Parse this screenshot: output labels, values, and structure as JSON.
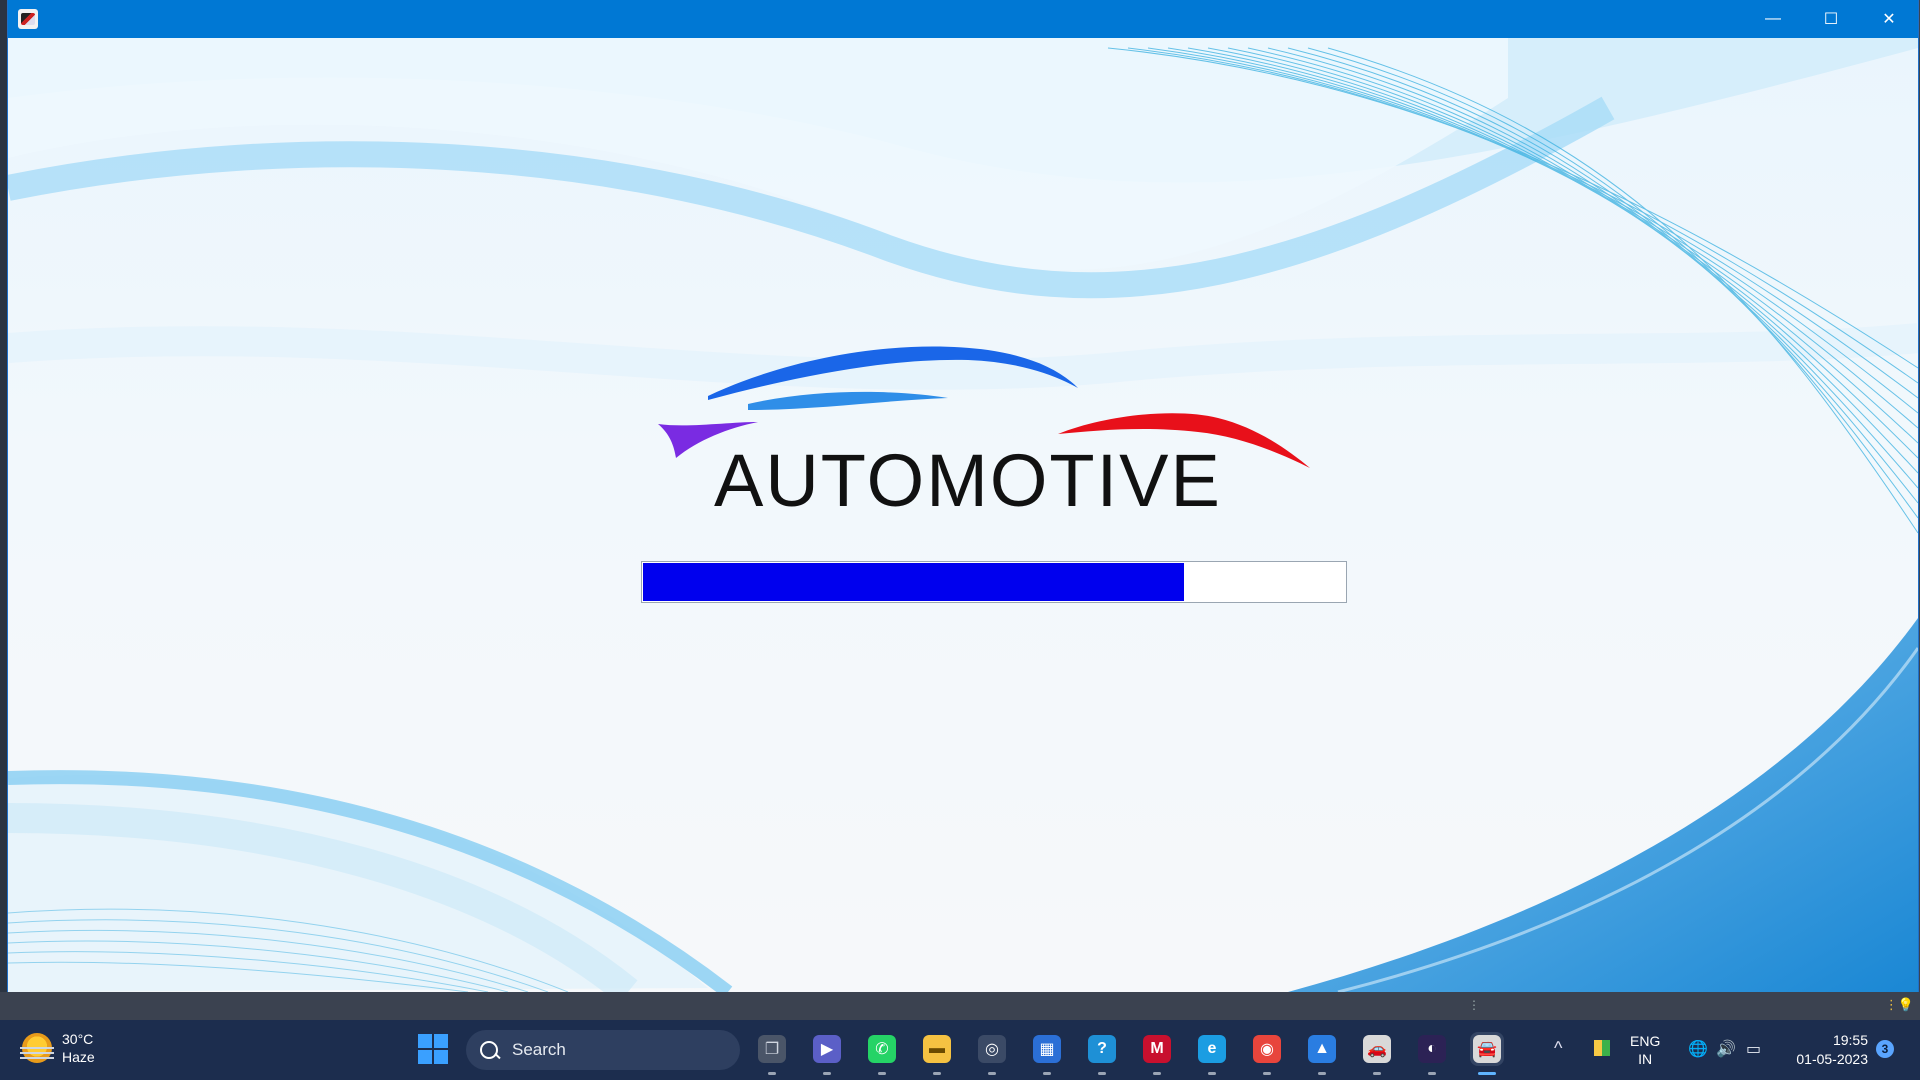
{
  "window": {
    "title": "",
    "controls": {
      "minimize": "—",
      "maximize": "☐",
      "close": "✕"
    }
  },
  "splash": {
    "logo_text": "AUTOMOTIVE",
    "progress_fraction": 0.77
  },
  "taskbar": {
    "weather": {
      "temperature": "30°C",
      "condition": "Haze"
    },
    "search_placeholder": "Search",
    "apps": [
      {
        "name": "task-view-icon",
        "glyph": "❐",
        "color": "#d0d6e0",
        "bg": "#4a5568"
      },
      {
        "name": "teams-icon",
        "glyph": "▶",
        "color": "#ffffff",
        "bg": "#5b5fc7"
      },
      {
        "name": "whatsapp-icon",
        "glyph": "✆",
        "color": "#ffffff",
        "bg": "#25d366"
      },
      {
        "name": "file-explorer-icon",
        "glyph": "▬",
        "color": "#6b4b00",
        "bg": "#f5c242"
      },
      {
        "name": "app-circle-icon",
        "glyph": "◎",
        "color": "#ffffff",
        "bg": "#3b4a66"
      },
      {
        "name": "microsoft-store-icon",
        "glyph": "▦",
        "color": "#ffffff",
        "bg": "#2b6fd6"
      },
      {
        "name": "help-icon",
        "glyph": "?",
        "color": "#ffffff",
        "bg": "#1e90d6"
      },
      {
        "name": "mcafee-icon",
        "glyph": "M",
        "color": "#ffffff",
        "bg": "#c8102e"
      },
      {
        "name": "edge-icon",
        "glyph": "e",
        "color": "#ffffff",
        "bg": "#1b9de2"
      },
      {
        "name": "chrome-icon",
        "glyph": "◉",
        "color": "#ffffff",
        "bg": "#e8453c"
      },
      {
        "name": "photos-icon",
        "glyph": "▲",
        "color": "#ffffff",
        "bg": "#2a7de1"
      },
      {
        "name": "car-app-icon",
        "glyph": "🚗",
        "color": "#ffffff",
        "bg": "#d9d9d9"
      },
      {
        "name": "eclipse-icon",
        "glyph": "◐",
        "color": "#ffffff",
        "bg": "#2c2255"
      },
      {
        "name": "automotive-app-icon",
        "glyph": "🚘",
        "color": "#ffffff",
        "bg": "#d9d9d9"
      }
    ],
    "tray": {
      "language_line1": "ENG",
      "language_line2": "IN",
      "time": "19:55",
      "date": "01-05-2023",
      "notification_count": "3"
    }
  },
  "colors": {
    "titlebar": "#0078d4",
    "progress_fill": "#0000ee",
    "taskbar": "#1c2d4e"
  }
}
